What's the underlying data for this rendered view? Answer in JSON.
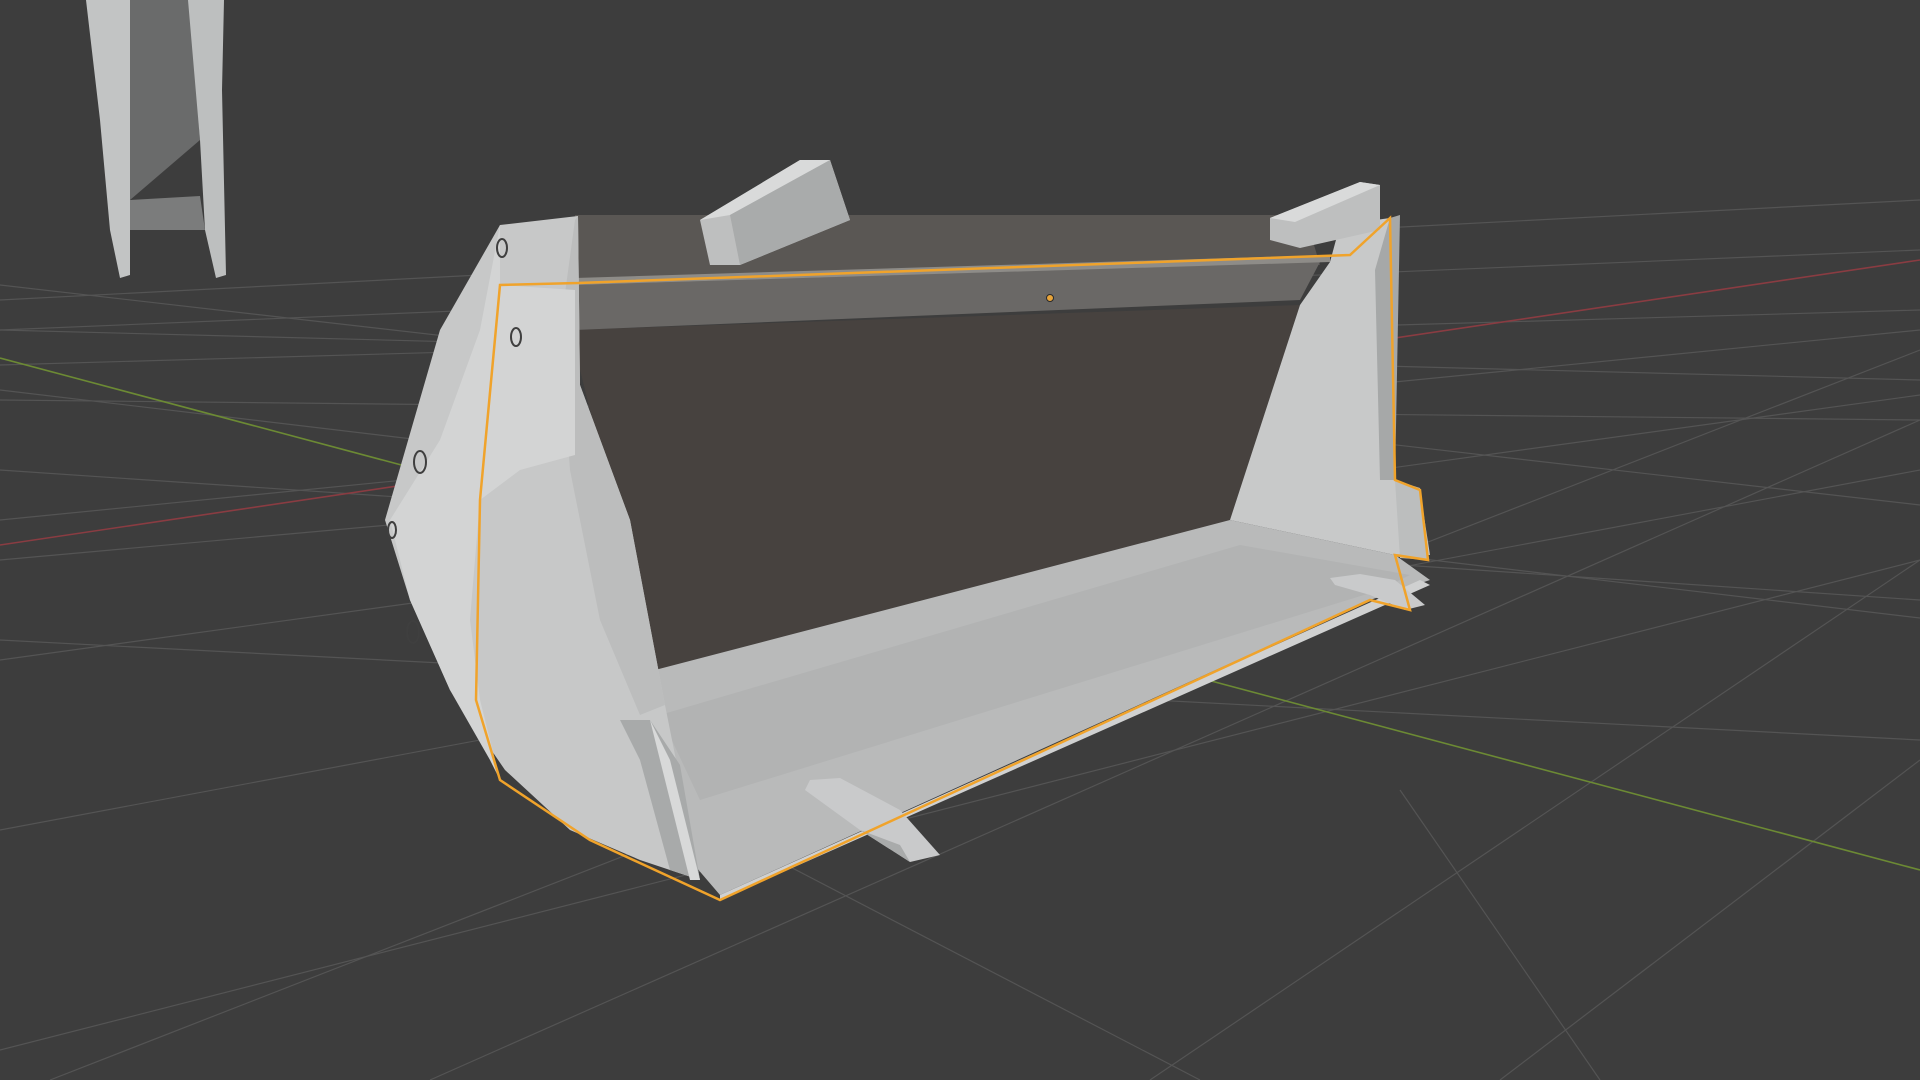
{
  "viewport": {
    "background_color": "#3d3d3d",
    "grid_color": "#545454",
    "x_axis_color": "#8a3c42",
    "y_axis_color": "#6c8a34",
    "selection_outline_color": "#f0a32b",
    "origin_dot_color": "#e8a43a"
  },
  "scene": {
    "selected_object": "bucket",
    "objects": [
      "bucket",
      "arm-fork"
    ]
  }
}
